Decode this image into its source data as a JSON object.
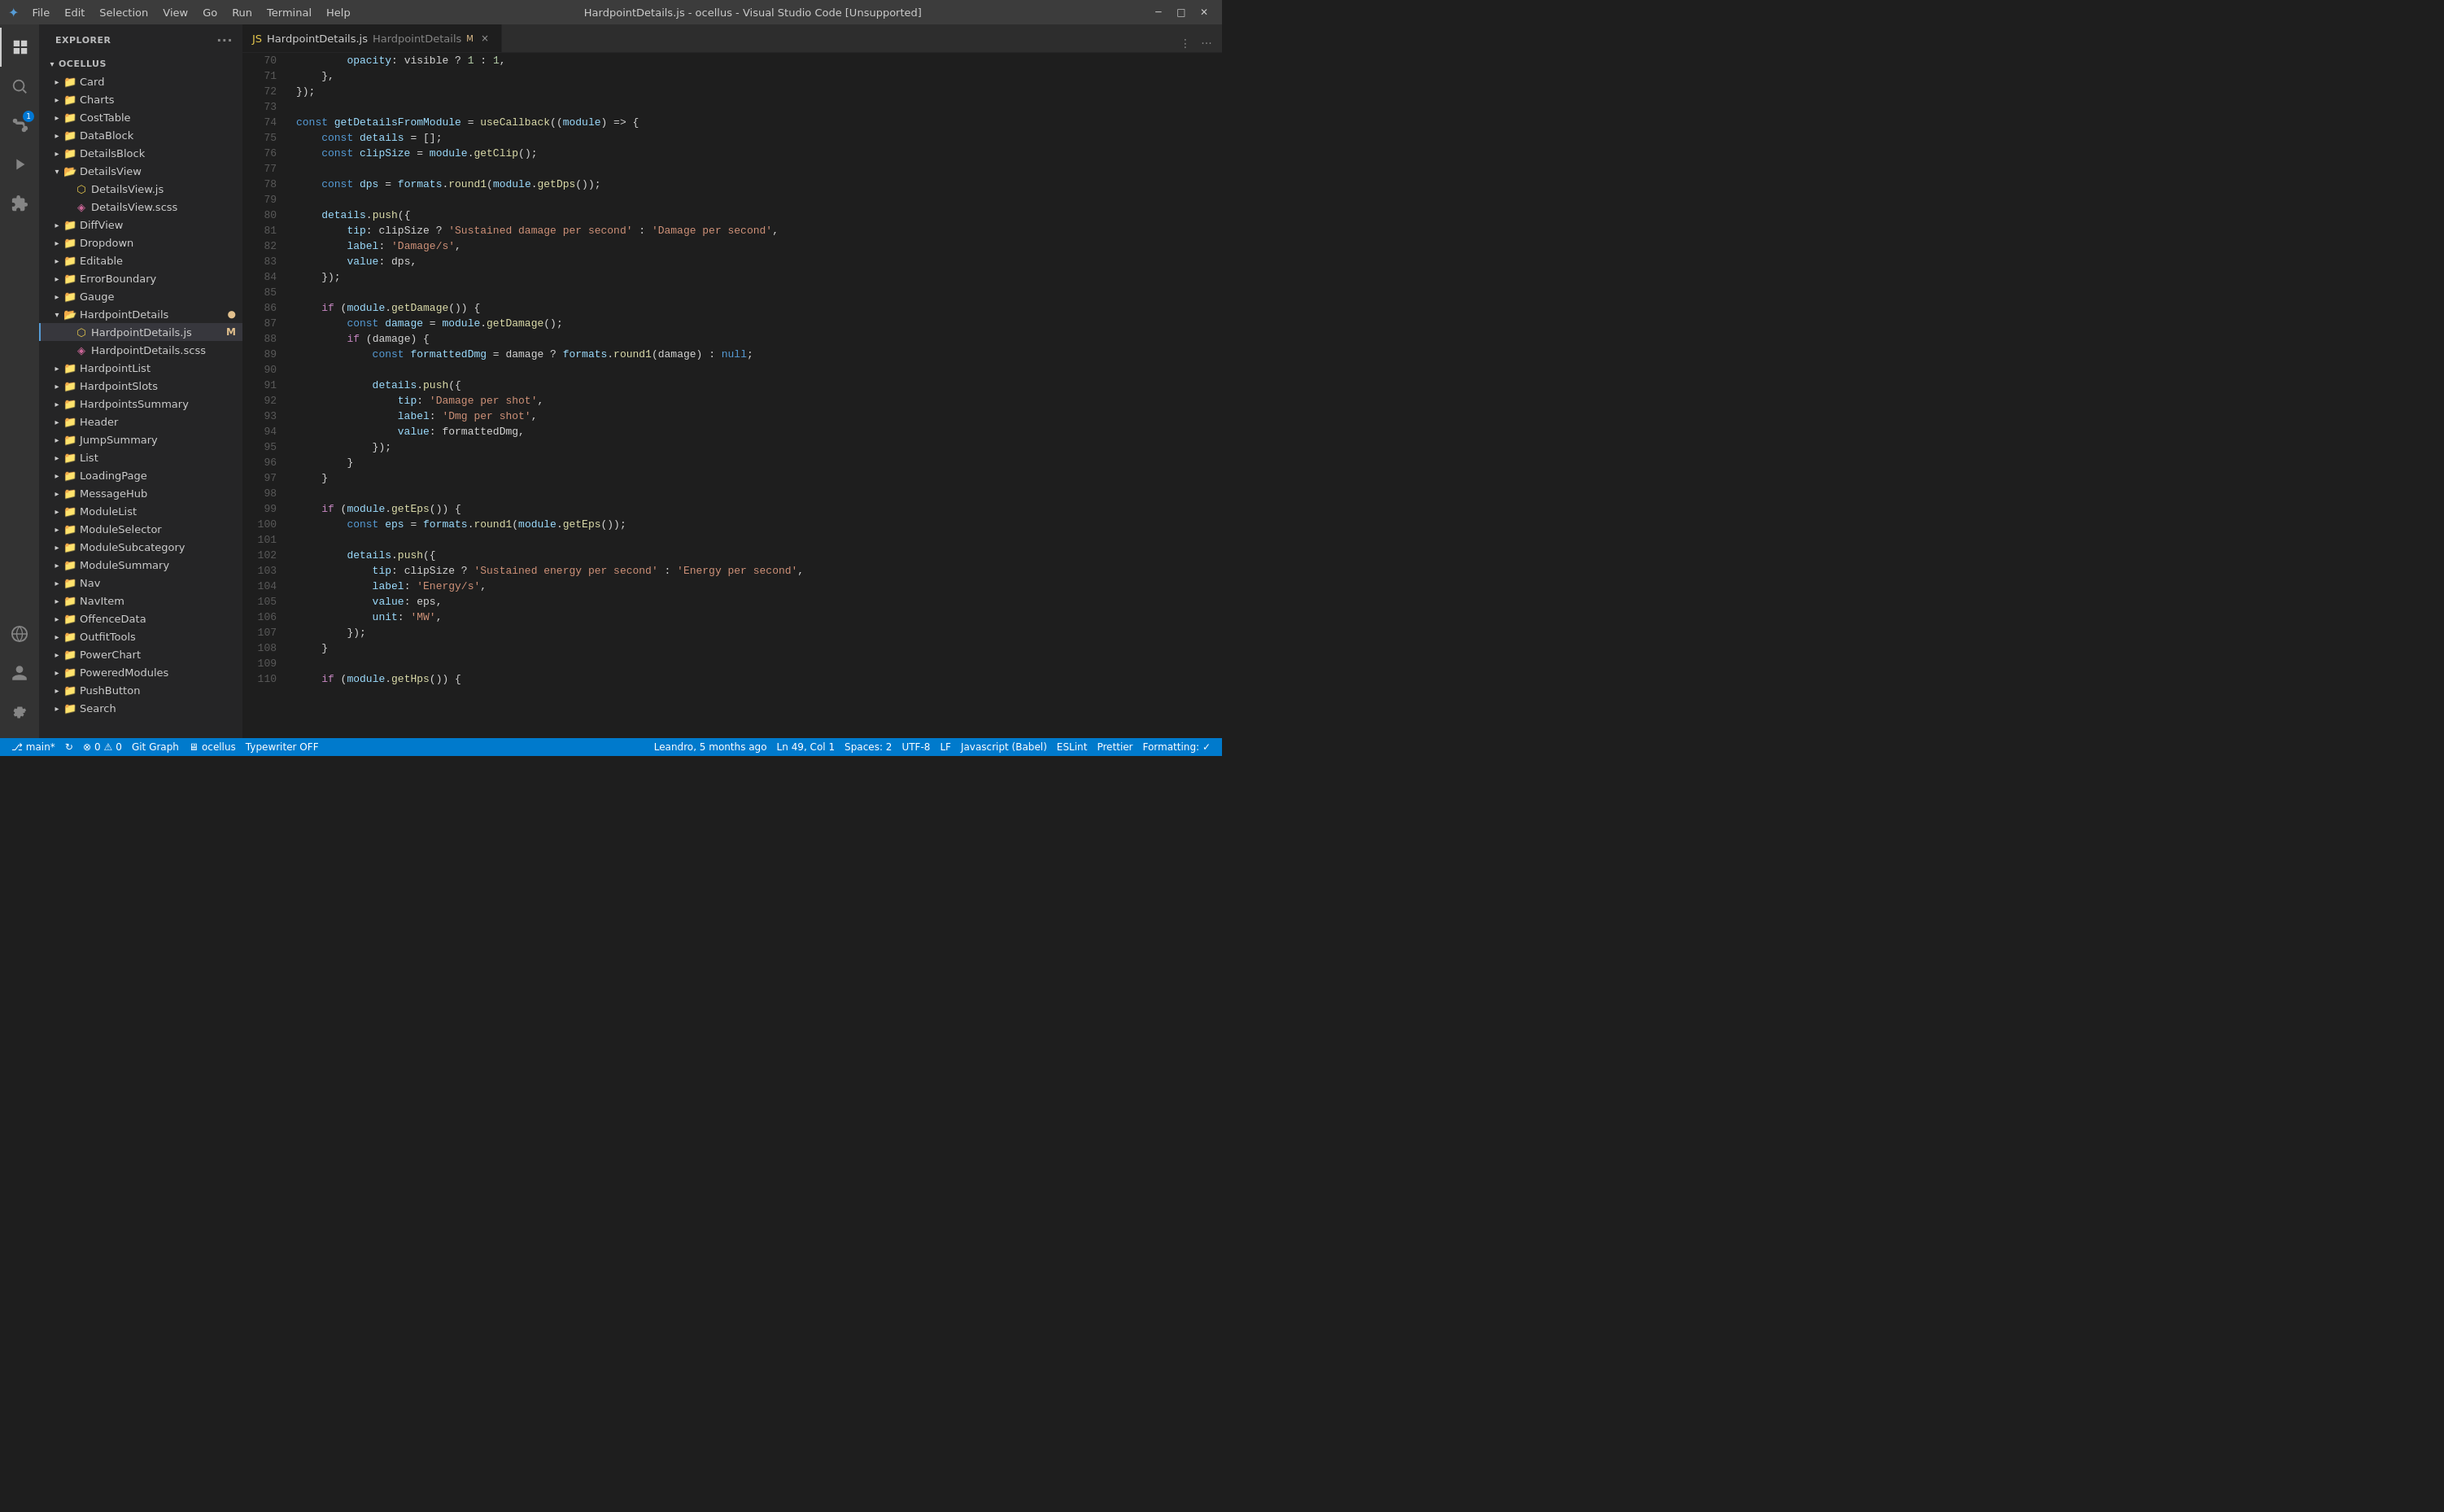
{
  "titleBar": {
    "icon": "✦",
    "menus": [
      "File",
      "Edit",
      "Selection",
      "View",
      "Go",
      "Run",
      "Terminal",
      "Help"
    ],
    "title": "HardpointDetails.js - ocellus - Visual Studio Code [Unsupported]",
    "minimize": "─",
    "maximize": "□",
    "close": "✕"
  },
  "activityBar": {
    "icons": [
      {
        "name": "explorer-icon",
        "symbol": "📄",
        "active": true
      },
      {
        "name": "search-icon",
        "symbol": "🔍",
        "active": false
      },
      {
        "name": "source-control-icon",
        "symbol": "⑂",
        "active": false,
        "badge": "1"
      },
      {
        "name": "run-icon",
        "symbol": "▷",
        "active": false
      },
      {
        "name": "extensions-icon",
        "symbol": "⊞",
        "active": false
      }
    ],
    "bottomIcons": [
      {
        "name": "remote-icon",
        "symbol": "⊙"
      },
      {
        "name": "account-icon",
        "symbol": "👤"
      },
      {
        "name": "settings-icon",
        "symbol": "⚙"
      }
    ]
  },
  "sidebar": {
    "title": "Explorer",
    "rootName": "OCELLUS",
    "items": [
      {
        "type": "folder",
        "name": "Card",
        "indent": 1,
        "open": false
      },
      {
        "type": "folder",
        "name": "Charts",
        "indent": 1,
        "open": false
      },
      {
        "type": "folder",
        "name": "CostTable",
        "indent": 1,
        "open": false
      },
      {
        "type": "folder",
        "name": "DataBlock",
        "indent": 1,
        "open": false
      },
      {
        "type": "folder",
        "name": "DetailsBlock",
        "indent": 1,
        "open": false
      },
      {
        "type": "folder",
        "name": "DetailsView",
        "indent": 1,
        "open": true
      },
      {
        "type": "file-js",
        "name": "DetailsView.js",
        "indent": 2
      },
      {
        "type": "file-scss",
        "name": "DetailsView.scss",
        "indent": 2
      },
      {
        "type": "folder",
        "name": "DiffView",
        "indent": 1,
        "open": false
      },
      {
        "type": "folder",
        "name": "Dropdown",
        "indent": 1,
        "open": false
      },
      {
        "type": "folder",
        "name": "Editable",
        "indent": 1,
        "open": false
      },
      {
        "type": "folder",
        "name": "ErrorBoundary",
        "indent": 1,
        "open": false
      },
      {
        "type": "folder",
        "name": "Gauge",
        "indent": 1,
        "open": false
      },
      {
        "type": "folder",
        "name": "HardpointDetails",
        "indent": 1,
        "open": true,
        "modified": true
      },
      {
        "type": "file-js",
        "name": "HardpointDetails.js",
        "indent": 2,
        "active": true,
        "modified": "M"
      },
      {
        "type": "file-scss",
        "name": "HardpointDetails.scss",
        "indent": 2
      },
      {
        "type": "folder",
        "name": "HardpointList",
        "indent": 1,
        "open": false
      },
      {
        "type": "folder",
        "name": "HardpointSlots",
        "indent": 1,
        "open": false
      },
      {
        "type": "folder",
        "name": "HardpointsSummary",
        "indent": 1,
        "open": false
      },
      {
        "type": "folder",
        "name": "Header",
        "indent": 1,
        "open": false
      },
      {
        "type": "folder",
        "name": "JumpSummary",
        "indent": 1,
        "open": false
      },
      {
        "type": "folder",
        "name": "List",
        "indent": 1,
        "open": false
      },
      {
        "type": "folder",
        "name": "LoadingPage",
        "indent": 1,
        "open": false
      },
      {
        "type": "folder",
        "name": "MessageHub",
        "indent": 1,
        "open": false
      },
      {
        "type": "folder",
        "name": "ModuleList",
        "indent": 1,
        "open": false
      },
      {
        "type": "folder",
        "name": "ModuleSelector",
        "indent": 1,
        "open": false
      },
      {
        "type": "folder",
        "name": "ModuleSubcategory",
        "indent": 1,
        "open": false
      },
      {
        "type": "folder",
        "name": "ModuleSummary",
        "indent": 1,
        "open": false
      },
      {
        "type": "folder",
        "name": "Nav",
        "indent": 1,
        "open": false
      },
      {
        "type": "folder",
        "name": "NavItem",
        "indent": 1,
        "open": false
      },
      {
        "type": "folder",
        "name": "OffenceData",
        "indent": 1,
        "open": false
      },
      {
        "type": "folder",
        "name": "OutfitTools",
        "indent": 1,
        "open": false
      },
      {
        "type": "folder",
        "name": "PowerChart",
        "indent": 1,
        "open": false
      },
      {
        "type": "folder",
        "name": "PoweredModules",
        "indent": 1,
        "open": false
      },
      {
        "type": "folder",
        "name": "PushButton",
        "indent": 1,
        "open": false
      },
      {
        "type": "folder",
        "name": "Search",
        "indent": 1,
        "open": false
      }
    ]
  },
  "tab": {
    "fileName": "HardpointDetails.js",
    "breadcrumb": "HardpointDetails",
    "modified": "M",
    "close": "×"
  },
  "codeLines": [
    {
      "num": 70,
      "tokens": [
        {
          "text": "        opacity",
          "cls": "prop"
        },
        {
          "text": ": visible ? ",
          "cls": "op"
        },
        {
          "text": "1",
          "cls": "num"
        },
        {
          "text": " : ",
          "cls": "op"
        },
        {
          "text": "1",
          "cls": "num"
        },
        {
          "text": ",",
          "cls": "op"
        }
      ]
    },
    {
      "num": 71,
      "tokens": [
        {
          "text": "    },",
          "cls": "op"
        }
      ]
    },
    {
      "num": 72,
      "tokens": [
        {
          "text": "});",
          "cls": "op"
        }
      ]
    },
    {
      "num": 73,
      "tokens": []
    },
    {
      "num": 74,
      "tokens": [
        {
          "text": "const ",
          "cls": "kw"
        },
        {
          "text": "getDetailsFromModule",
          "cls": "var"
        },
        {
          "text": " = ",
          "cls": "op"
        },
        {
          "text": "useCallback",
          "cls": "fn"
        },
        {
          "text": "((",
          "cls": "punc"
        },
        {
          "text": "module",
          "cls": "var"
        },
        {
          "text": ") => {",
          "cls": "op"
        }
      ]
    },
    {
      "num": 75,
      "tokens": [
        {
          "text": "    const ",
          "cls": "kw"
        },
        {
          "text": "details",
          "cls": "var"
        },
        {
          "text": " = [];",
          "cls": "op"
        }
      ]
    },
    {
      "num": 76,
      "tokens": [
        {
          "text": "    const ",
          "cls": "kw"
        },
        {
          "text": "clipSize",
          "cls": "var"
        },
        {
          "text": " = ",
          "cls": "op"
        },
        {
          "text": "module",
          "cls": "var"
        },
        {
          "text": ".",
          "cls": "op"
        },
        {
          "text": "getClip",
          "cls": "fn"
        },
        {
          "text": "();",
          "cls": "op"
        }
      ]
    },
    {
      "num": 77,
      "tokens": []
    },
    {
      "num": 78,
      "tokens": [
        {
          "text": "    const ",
          "cls": "kw"
        },
        {
          "text": "dps",
          "cls": "var"
        },
        {
          "text": " = ",
          "cls": "op"
        },
        {
          "text": "formats",
          "cls": "var"
        },
        {
          "text": ".",
          "cls": "op"
        },
        {
          "text": "round1",
          "cls": "fn"
        },
        {
          "text": "(",
          "cls": "punc"
        },
        {
          "text": "module",
          "cls": "var"
        },
        {
          "text": ".",
          "cls": "op"
        },
        {
          "text": "getDps",
          "cls": "fn"
        },
        {
          "text": "());",
          "cls": "op"
        }
      ]
    },
    {
      "num": 79,
      "tokens": []
    },
    {
      "num": 80,
      "tokens": [
        {
          "text": "    details",
          "cls": "var"
        },
        {
          "text": ".",
          "cls": "op"
        },
        {
          "text": "push",
          "cls": "fn"
        },
        {
          "text": "({",
          "cls": "punc"
        }
      ]
    },
    {
      "num": 81,
      "tokens": [
        {
          "text": "        tip",
          "cls": "prop"
        },
        {
          "text": ": clipSize ? ",
          "cls": "op"
        },
        {
          "text": "'Sustained damage per second'",
          "cls": "str"
        },
        {
          "text": " : ",
          "cls": "op"
        },
        {
          "text": "'Damage per second'",
          "cls": "str"
        },
        {
          "text": ",",
          "cls": "op"
        }
      ]
    },
    {
      "num": 82,
      "tokens": [
        {
          "text": "        label",
          "cls": "prop"
        },
        {
          "text": ": ",
          "cls": "op"
        },
        {
          "text": "'Damage/s'",
          "cls": "str"
        },
        {
          "text": ",",
          "cls": "op"
        }
      ]
    },
    {
      "num": 83,
      "tokens": [
        {
          "text": "        value",
          "cls": "prop"
        },
        {
          "text": ": dps,",
          "cls": "op"
        }
      ]
    },
    {
      "num": 84,
      "tokens": [
        {
          "text": "    });",
          "cls": "op"
        }
      ]
    },
    {
      "num": 85,
      "tokens": []
    },
    {
      "num": 86,
      "tokens": [
        {
          "text": "    if ",
          "cls": "kw2"
        },
        {
          "text": "(",
          "cls": "punc"
        },
        {
          "text": "module",
          "cls": "var"
        },
        {
          "text": ".",
          "cls": "op"
        },
        {
          "text": "getDamage",
          "cls": "fn"
        },
        {
          "text": "()) {",
          "cls": "op"
        }
      ]
    },
    {
      "num": 87,
      "tokens": [
        {
          "text": "        const ",
          "cls": "kw"
        },
        {
          "text": "damage",
          "cls": "var"
        },
        {
          "text": " = ",
          "cls": "op"
        },
        {
          "text": "module",
          "cls": "var"
        },
        {
          "text": ".",
          "cls": "op"
        },
        {
          "text": "getDamage",
          "cls": "fn"
        },
        {
          "text": "();",
          "cls": "op"
        }
      ]
    },
    {
      "num": 88,
      "tokens": [
        {
          "text": "        if ",
          "cls": "kw2"
        },
        {
          "text": "(damage) {",
          "cls": "op"
        }
      ]
    },
    {
      "num": 89,
      "tokens": [
        {
          "text": "            const ",
          "cls": "kw"
        },
        {
          "text": "formattedDmg",
          "cls": "var"
        },
        {
          "text": " = damage ? ",
          "cls": "op"
        },
        {
          "text": "formats",
          "cls": "var"
        },
        {
          "text": ".",
          "cls": "op"
        },
        {
          "text": "round1",
          "cls": "fn"
        },
        {
          "text": "(damage) : ",
          "cls": "op"
        },
        {
          "text": "null",
          "cls": "kw"
        },
        {
          "text": ";",
          "cls": "op"
        }
      ]
    },
    {
      "num": 90,
      "tokens": []
    },
    {
      "num": 91,
      "tokens": [
        {
          "text": "            details",
          "cls": "var"
        },
        {
          "text": ".",
          "cls": "op"
        },
        {
          "text": "push",
          "cls": "fn"
        },
        {
          "text": "({",
          "cls": "punc"
        }
      ]
    },
    {
      "num": 92,
      "tokens": [
        {
          "text": "                tip",
          "cls": "prop"
        },
        {
          "text": ": ",
          "cls": "op"
        },
        {
          "text": "'Damage per shot'",
          "cls": "str"
        },
        {
          "text": ",",
          "cls": "op"
        }
      ]
    },
    {
      "num": 93,
      "tokens": [
        {
          "text": "                label",
          "cls": "prop"
        },
        {
          "text": ": ",
          "cls": "op"
        },
        {
          "text": "'Dmg per shot'",
          "cls": "str"
        },
        {
          "text": ",",
          "cls": "op"
        }
      ]
    },
    {
      "num": 94,
      "tokens": [
        {
          "text": "                value",
          "cls": "prop"
        },
        {
          "text": ": formattedDmg,",
          "cls": "op"
        }
      ]
    },
    {
      "num": 95,
      "tokens": [
        {
          "text": "            });",
          "cls": "op"
        }
      ]
    },
    {
      "num": 96,
      "tokens": [
        {
          "text": "        }",
          "cls": "op"
        }
      ]
    },
    {
      "num": 97,
      "tokens": [
        {
          "text": "    }",
          "cls": "op"
        }
      ]
    },
    {
      "num": 98,
      "tokens": []
    },
    {
      "num": 99,
      "tokens": [
        {
          "text": "    if ",
          "cls": "kw2"
        },
        {
          "text": "(",
          "cls": "punc"
        },
        {
          "text": "module",
          "cls": "var"
        },
        {
          "text": ".",
          "cls": "op"
        },
        {
          "text": "getEps",
          "cls": "fn"
        },
        {
          "text": "()) {",
          "cls": "op"
        }
      ]
    },
    {
      "num": 100,
      "tokens": [
        {
          "text": "        const ",
          "cls": "kw"
        },
        {
          "text": "eps",
          "cls": "var"
        },
        {
          "text": " = ",
          "cls": "op"
        },
        {
          "text": "formats",
          "cls": "var"
        },
        {
          "text": ".",
          "cls": "op"
        },
        {
          "text": "round1",
          "cls": "fn"
        },
        {
          "text": "(",
          "cls": "punc"
        },
        {
          "text": "module",
          "cls": "var"
        },
        {
          "text": ".",
          "cls": "op"
        },
        {
          "text": "getEps",
          "cls": "fn"
        },
        {
          "text": "());",
          "cls": "op"
        }
      ]
    },
    {
      "num": 101,
      "tokens": []
    },
    {
      "num": 102,
      "tokens": [
        {
          "text": "        details",
          "cls": "var"
        },
        {
          "text": ".",
          "cls": "op"
        },
        {
          "text": "push",
          "cls": "fn"
        },
        {
          "text": "({",
          "cls": "punc"
        }
      ]
    },
    {
      "num": 103,
      "tokens": [
        {
          "text": "            tip",
          "cls": "prop"
        },
        {
          "text": ": clipSize ? ",
          "cls": "op"
        },
        {
          "text": "'Sustained energy per second'",
          "cls": "str"
        },
        {
          "text": " : ",
          "cls": "op"
        },
        {
          "text": "'Energy per second'",
          "cls": "str"
        },
        {
          "text": ",",
          "cls": "op"
        }
      ]
    },
    {
      "num": 104,
      "tokens": [
        {
          "text": "            label",
          "cls": "prop"
        },
        {
          "text": ": ",
          "cls": "op"
        },
        {
          "text": "'Energy/s'",
          "cls": "str"
        },
        {
          "text": ",",
          "cls": "op"
        }
      ]
    },
    {
      "num": 105,
      "tokens": [
        {
          "text": "            value",
          "cls": "prop"
        },
        {
          "text": ": eps,",
          "cls": "op"
        }
      ]
    },
    {
      "num": 106,
      "tokens": [
        {
          "text": "            unit",
          "cls": "prop"
        },
        {
          "text": ": ",
          "cls": "op"
        },
        {
          "text": "'MW'",
          "cls": "str"
        },
        {
          "text": ",",
          "cls": "op"
        }
      ]
    },
    {
      "num": 107,
      "tokens": [
        {
          "text": "        });",
          "cls": "op"
        }
      ]
    },
    {
      "num": 108,
      "tokens": [
        {
          "text": "    }",
          "cls": "op"
        }
      ]
    },
    {
      "num": 109,
      "tokens": []
    },
    {
      "num": 110,
      "tokens": [
        {
          "text": "    if ",
          "cls": "kw2"
        },
        {
          "text": "(",
          "cls": "punc"
        },
        {
          "text": "module",
          "cls": "var"
        },
        {
          "text": ".",
          "cls": "op"
        },
        {
          "text": "getHps",
          "cls": "fn"
        },
        {
          "text": "()) {",
          "cls": "op"
        }
      ]
    }
  ],
  "statusBar": {
    "branch": "main*",
    "syncIcon": "↻",
    "errors": "0",
    "warnings": "0",
    "gitGraph": "Git Graph",
    "remote": "ocellus",
    "typewriter": "Typewriter OFF",
    "position": "Ln 49, Col 1",
    "spaces": "Spaces: 2",
    "encoding": "UTF-8",
    "lineEnding": "LF",
    "language": "Javascript (Babel)",
    "linter": "ESLint",
    "formatter": "Prettier",
    "formatting": "Formatting: ✓",
    "user": "Leandro, 5 months ago"
  }
}
